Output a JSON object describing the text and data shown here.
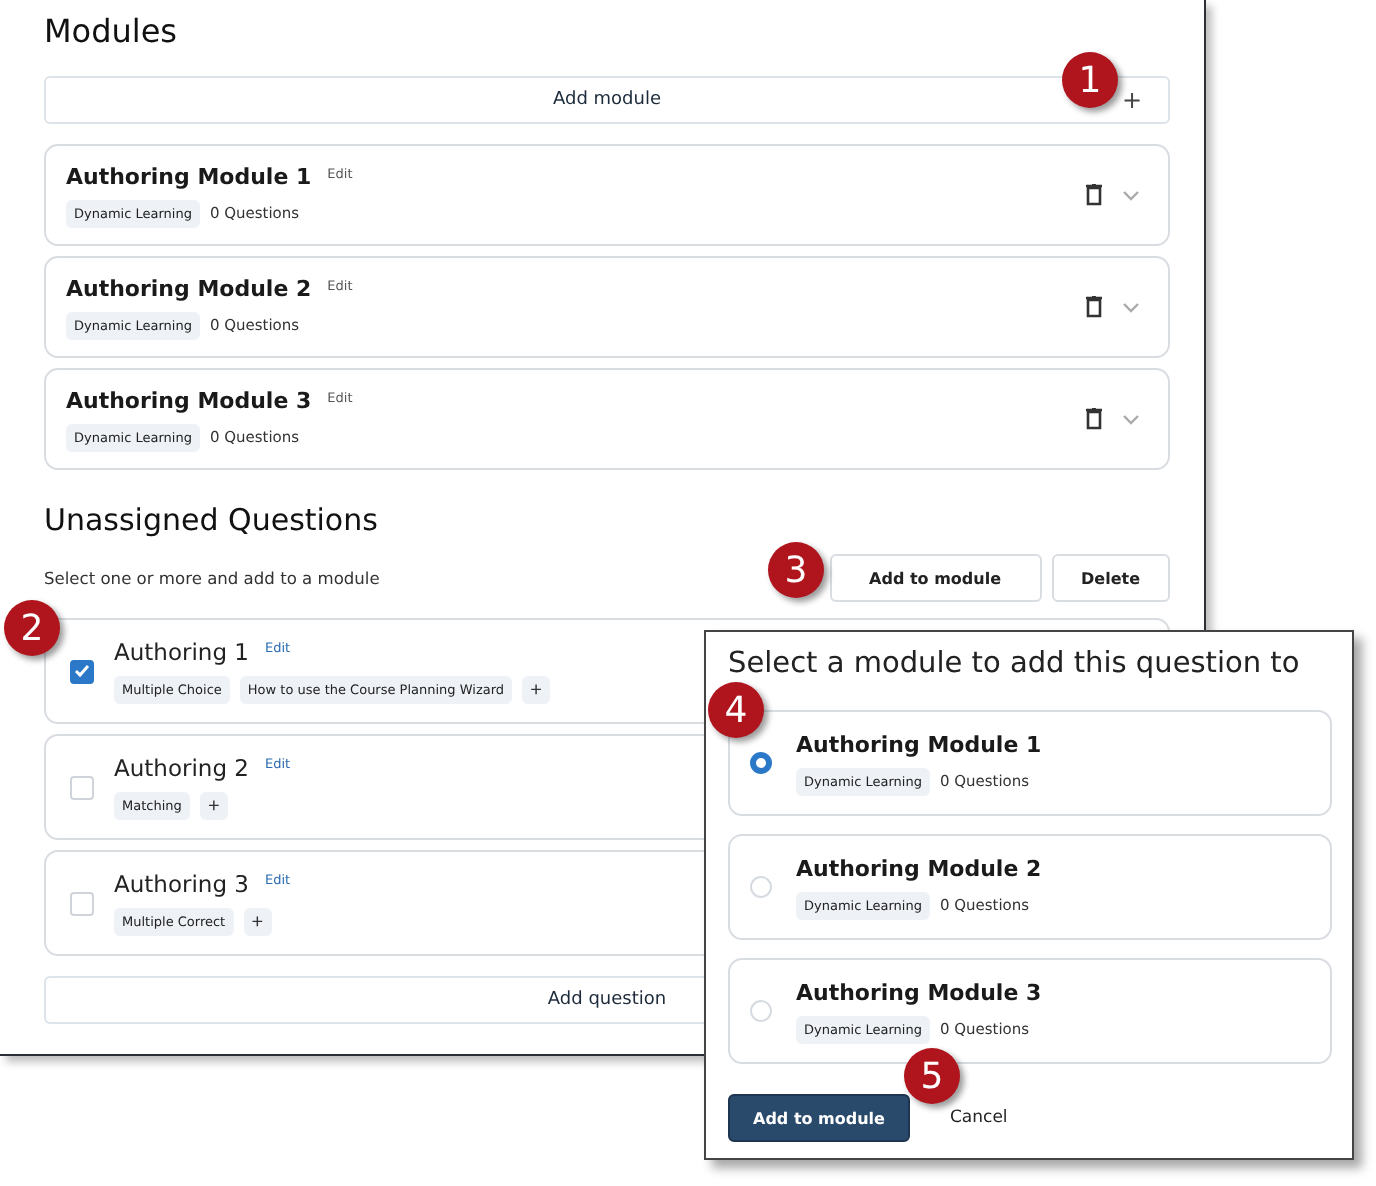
{
  "modules_section": {
    "title": "Modules",
    "add_button": {
      "label": "Add module",
      "icon": "+"
    },
    "modules": [
      {
        "title": "Authoring Module 1",
        "edit": "Edit",
        "tag": "Dynamic Learning",
        "count": "0 Questions"
      },
      {
        "title": "Authoring Module 2",
        "edit": "Edit",
        "tag": "Dynamic Learning",
        "count": "0 Questions"
      },
      {
        "title": "Authoring Module 3",
        "edit": "Edit",
        "tag": "Dynamic Learning",
        "count": "0 Questions"
      }
    ]
  },
  "unassigned": {
    "title": "Unassigned Questions",
    "hint": "Select one or more and add to a module",
    "actions": [
      "Add to module",
      "Delete"
    ],
    "questions": [
      {
        "title": "Authoring 1",
        "edit": "Edit",
        "checked": true,
        "tags": [
          "Multiple Choice",
          "How to use the Course Planning Wizard"
        ],
        "add_tag": "+"
      },
      {
        "title": "Authoring 2",
        "edit": "Edit",
        "checked": false,
        "tags": [
          "Matching"
        ],
        "add_tag": "+"
      },
      {
        "title": "Authoring 3",
        "edit": "Edit",
        "checked": false,
        "tags": [
          "Multiple Correct"
        ],
        "add_tag": "+"
      }
    ],
    "add_button": "Add question"
  },
  "dialog": {
    "title": "Select a module to add this question to",
    "options": [
      {
        "title": "Authoring Module 1",
        "tag": "Dynamic Learning",
        "count": "0 Questions",
        "selected": true
      },
      {
        "title": "Authoring Module 2",
        "tag": "Dynamic Learning",
        "count": "0 Questions",
        "selected": false
      },
      {
        "title": "Authoring Module 3",
        "tag": "Dynamic Learning",
        "count": "0 Questions",
        "selected": false
      }
    ],
    "primary": "Add to module",
    "secondary": "Cancel"
  },
  "callouts": [
    "1",
    "2",
    "3",
    "4",
    "5"
  ]
}
